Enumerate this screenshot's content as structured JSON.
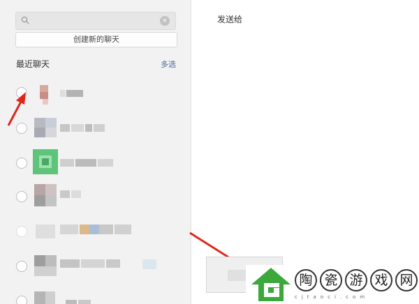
{
  "search": {
    "placeholder": "",
    "clear_glyph": "×"
  },
  "create_button": "创建新的聊天",
  "recent": {
    "title": "最近聊天",
    "multi_select": "多选"
  },
  "right": {
    "send_to": "发送给"
  },
  "icons": {
    "search": "search-icon",
    "clear": "close-icon",
    "arrow": "red-arrow-icon",
    "logo": "house-logo-icon"
  },
  "colors": {
    "accent_link": "#4a6aa5",
    "arrow_red": "#e0261b",
    "logo_green": "#3aa83a"
  },
  "watermark": {
    "chars": [
      "陶",
      "瓷",
      "游",
      "戏",
      "网"
    ],
    "url": "cjtaoci.com"
  }
}
